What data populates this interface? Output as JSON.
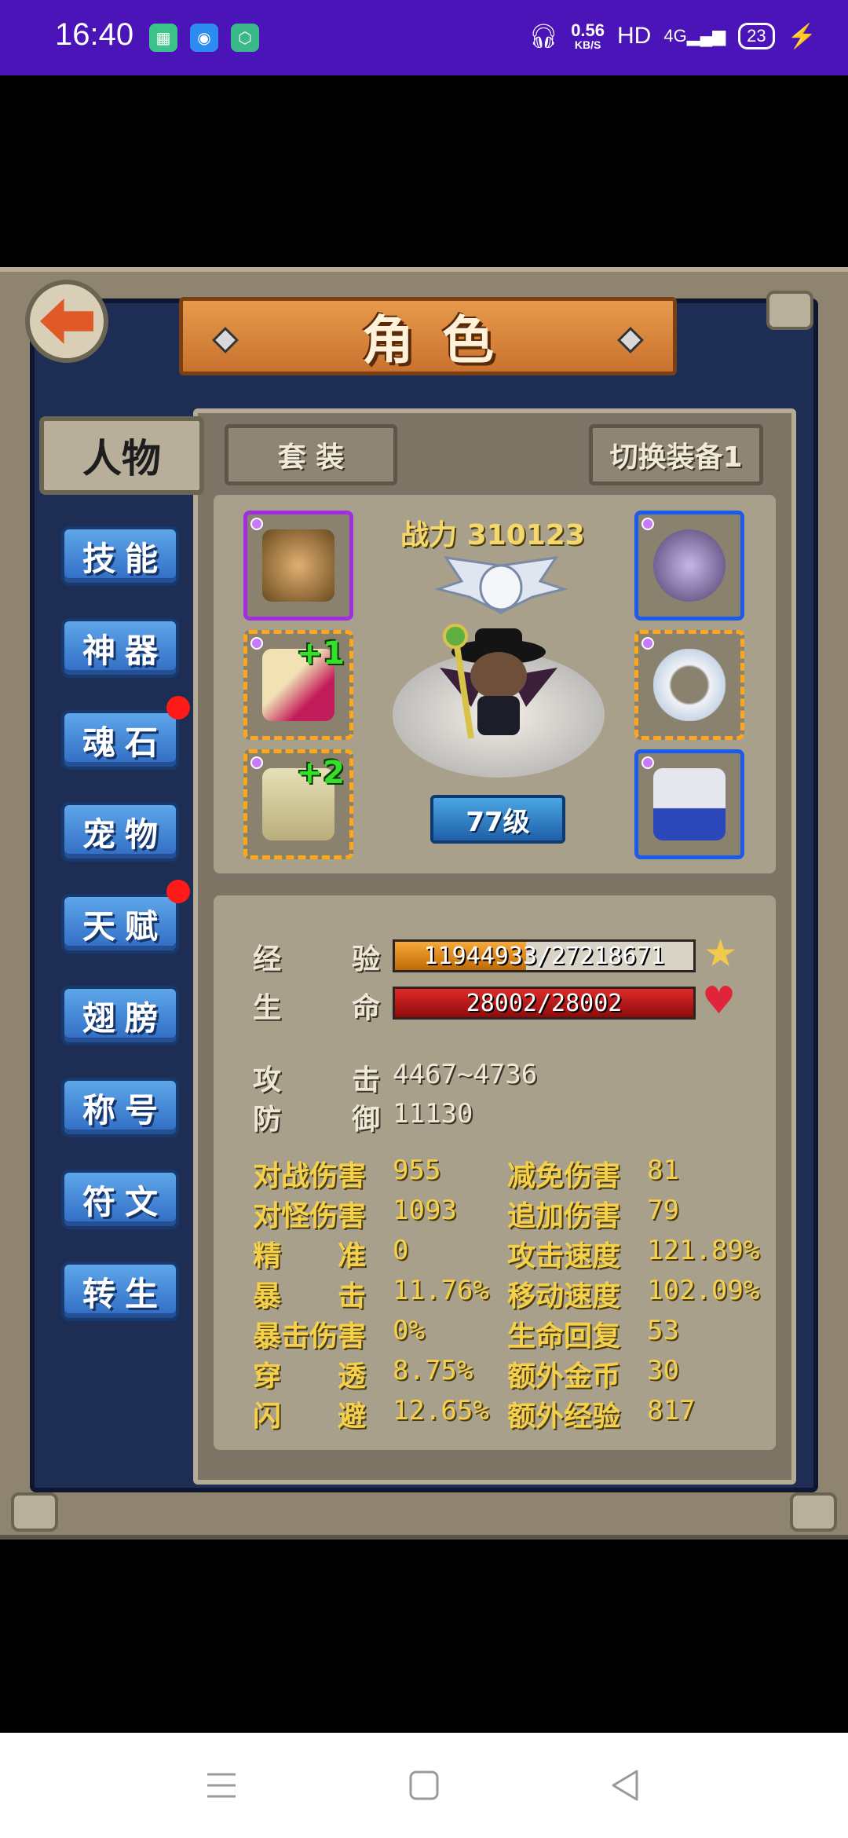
{
  "status": {
    "time": "16:40",
    "speed_value": "0.56",
    "speed_unit": "KB/S",
    "hd": "HD",
    "network": "4G",
    "battery": "23"
  },
  "header": {
    "title": "角色"
  },
  "tabs": {
    "active": "人物",
    "set": "套 装",
    "switch": "切换装备1"
  },
  "sidebar": {
    "items": [
      {
        "label": "技能",
        "badge": false
      },
      {
        "label": "神器",
        "badge": false
      },
      {
        "label": "魂石",
        "badge": true
      },
      {
        "label": "宠物",
        "badge": false
      },
      {
        "label": "天赋",
        "badge": true
      },
      {
        "label": "翅膀",
        "badge": false
      },
      {
        "label": "称号",
        "badge": false
      },
      {
        "label": "符文",
        "badge": false
      },
      {
        "label": "转生",
        "badge": false
      }
    ]
  },
  "equipment": {
    "power_label": "战力",
    "power_value": "310123",
    "level": "77级",
    "slots": [
      {
        "name": "armor",
        "quality": "purple",
        "plus": ""
      },
      {
        "name": "bracer",
        "quality": "orange",
        "plus": "+1"
      },
      {
        "name": "scroll",
        "quality": "orange",
        "plus": "+2"
      },
      {
        "name": "helmet",
        "quality": "blue",
        "plus": ""
      },
      {
        "name": "ring",
        "quality": "orange",
        "plus": ""
      },
      {
        "name": "boots",
        "quality": "blue",
        "plus": ""
      }
    ]
  },
  "stats": {
    "exp_label_1": "经",
    "exp_label_2": "验",
    "exp_value": "11944933/27218671",
    "exp_ratio": 0.439,
    "hp_label_1": "生",
    "hp_label_2": "命",
    "hp_value": "28002/28002",
    "hp_ratio": 1.0,
    "atk_label_1": "攻",
    "atk_label_2": "击",
    "atk_value": "4467~4736",
    "def_label_1": "防",
    "def_label_2": "御",
    "def_value": "11130",
    "left_col": [
      {
        "label": "对战伤害",
        "value": "955"
      },
      {
        "label": "对怪伤害",
        "value": "1093"
      },
      {
        "label": "精　　准",
        "value": "0"
      },
      {
        "label": "暴　　击",
        "value": "11.76%"
      },
      {
        "label": "暴击伤害",
        "value": "0%"
      },
      {
        "label": "穿　　透",
        "value": "8.75%"
      },
      {
        "label": "闪　　避",
        "value": "12.65%"
      }
    ],
    "right_col": [
      {
        "label": "减免伤害",
        "value": "81"
      },
      {
        "label": "追加伤害",
        "value": "79"
      },
      {
        "label": "攻击速度",
        "value": "121.89%"
      },
      {
        "label": "移动速度",
        "value": "102.09%"
      },
      {
        "label": "生命回复",
        "value": "53"
      },
      {
        "label": "额外金币",
        "value": "30"
      },
      {
        "label": "额外经验",
        "value": "817"
      }
    ]
  },
  "colors": {
    "status_bar": "#4a14b8",
    "exp_bar": "#e68a12",
    "hp_bar": "#c01515"
  }
}
